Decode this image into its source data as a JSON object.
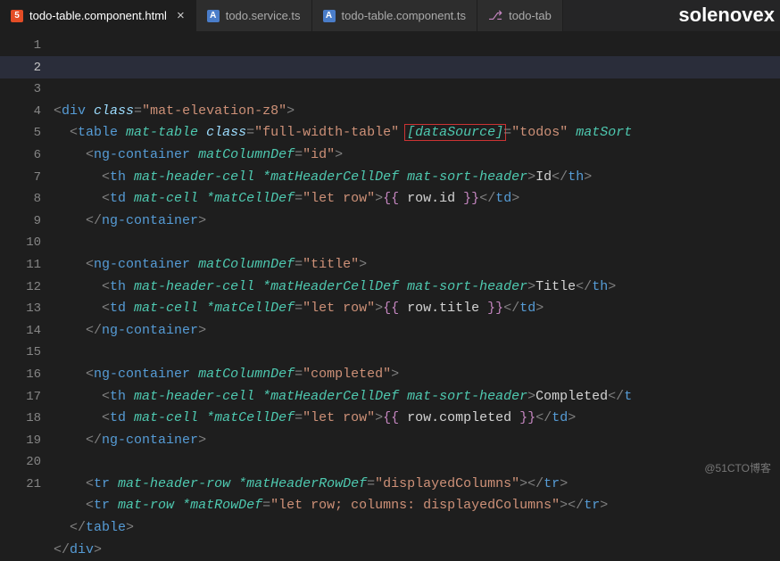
{
  "tabs": [
    {
      "label": "todo-table.component.html",
      "icon": "html",
      "active": true,
      "closeVisible": true
    },
    {
      "label": "todo.service.ts",
      "icon": "ts",
      "active": false,
      "closeVisible": false
    },
    {
      "label": "todo-table.component.ts",
      "icon": "ts",
      "active": false,
      "closeVisible": false
    },
    {
      "label": "todo-tab",
      "icon": "git",
      "active": false,
      "closeVisible": false
    }
  ],
  "watermark_top": "solenovex",
  "watermark_bottom": "@51CTO博客",
  "gutter_start": 1,
  "gutter_end": 21,
  "current_line": 2,
  "code_lines": [
    [
      {
        "t": "<",
        "c": "punc"
      },
      {
        "t": "div",
        "c": "tag"
      },
      {
        "t": " class",
        "c": "attr"
      },
      {
        "t": "=",
        "c": "punc"
      },
      {
        "t": "\"mat-elevation-z8\"",
        "c": "str"
      },
      {
        "t": ">",
        "c": "punc"
      }
    ],
    [
      {
        "t": "  ",
        "c": "text"
      },
      {
        "t": "<",
        "c": "punc"
      },
      {
        "t": "table",
        "c": "tag"
      },
      {
        "t": " mat-table",
        "c": "dir"
      },
      {
        "t": " class",
        "c": "attr"
      },
      {
        "t": "=",
        "c": "punc"
      },
      {
        "t": "\"full-width-table\"",
        "c": "str"
      },
      {
        "t": " ",
        "c": "text"
      },
      {
        "t": "[dataSource]",
        "c": "dir",
        "box": true
      },
      {
        "t": "=",
        "c": "punc"
      },
      {
        "t": "\"todos\"",
        "c": "str"
      },
      {
        "t": " matSort",
        "c": "dir"
      }
    ],
    [
      {
        "t": "    ",
        "c": "text"
      },
      {
        "t": "<",
        "c": "punc"
      },
      {
        "t": "ng-container",
        "c": "tag"
      },
      {
        "t": " matColumnDef",
        "c": "dir"
      },
      {
        "t": "=",
        "c": "punc"
      },
      {
        "t": "\"id\"",
        "c": "str"
      },
      {
        "t": ">",
        "c": "punc"
      }
    ],
    [
      {
        "t": "      ",
        "c": "text"
      },
      {
        "t": "<",
        "c": "punc"
      },
      {
        "t": "th",
        "c": "tag"
      },
      {
        "t": " mat-header-cell",
        "c": "dir"
      },
      {
        "t": " *matHeaderCellDef",
        "c": "dir"
      },
      {
        "t": " mat-sort-header",
        "c": "dir"
      },
      {
        "t": ">",
        "c": "punc"
      },
      {
        "t": "Id",
        "c": "text"
      },
      {
        "t": "</",
        "c": "punc"
      },
      {
        "t": "th",
        "c": "tag"
      },
      {
        "t": ">",
        "c": "punc"
      }
    ],
    [
      {
        "t": "      ",
        "c": "text"
      },
      {
        "t": "<",
        "c": "punc"
      },
      {
        "t": "td",
        "c": "tag"
      },
      {
        "t": " mat-cell",
        "c": "dir"
      },
      {
        "t": " *matCellDef",
        "c": "dir"
      },
      {
        "t": "=",
        "c": "punc"
      },
      {
        "t": "\"let row\"",
        "c": "str"
      },
      {
        "t": ">",
        "c": "punc"
      },
      {
        "t": "{{ ",
        "c": "brace"
      },
      {
        "t": "row.id",
        "c": "ident"
      },
      {
        "t": " }}",
        "c": "brace"
      },
      {
        "t": "</",
        "c": "punc"
      },
      {
        "t": "td",
        "c": "tag"
      },
      {
        "t": ">",
        "c": "punc"
      }
    ],
    [
      {
        "t": "    ",
        "c": "text"
      },
      {
        "t": "</",
        "c": "punc"
      },
      {
        "t": "ng-container",
        "c": "tag"
      },
      {
        "t": ">",
        "c": "punc"
      }
    ],
    [],
    [
      {
        "t": "    ",
        "c": "text"
      },
      {
        "t": "<",
        "c": "punc"
      },
      {
        "t": "ng-container",
        "c": "tag"
      },
      {
        "t": " matColumnDef",
        "c": "dir"
      },
      {
        "t": "=",
        "c": "punc"
      },
      {
        "t": "\"title\"",
        "c": "str"
      },
      {
        "t": ">",
        "c": "punc"
      }
    ],
    [
      {
        "t": "      ",
        "c": "text"
      },
      {
        "t": "<",
        "c": "punc"
      },
      {
        "t": "th",
        "c": "tag"
      },
      {
        "t": " mat-header-cell",
        "c": "dir"
      },
      {
        "t": " *matHeaderCellDef",
        "c": "dir"
      },
      {
        "t": " mat-sort-header",
        "c": "dir"
      },
      {
        "t": ">",
        "c": "punc"
      },
      {
        "t": "Title",
        "c": "text"
      },
      {
        "t": "</",
        "c": "punc"
      },
      {
        "t": "th",
        "c": "tag"
      },
      {
        "t": ">",
        "c": "punc"
      }
    ],
    [
      {
        "t": "      ",
        "c": "text"
      },
      {
        "t": "<",
        "c": "punc"
      },
      {
        "t": "td",
        "c": "tag"
      },
      {
        "t": " mat-cell",
        "c": "dir"
      },
      {
        "t": " *matCellDef",
        "c": "dir"
      },
      {
        "t": "=",
        "c": "punc"
      },
      {
        "t": "\"let row\"",
        "c": "str"
      },
      {
        "t": ">",
        "c": "punc"
      },
      {
        "t": "{{ ",
        "c": "brace"
      },
      {
        "t": "row.title",
        "c": "ident"
      },
      {
        "t": " }}",
        "c": "brace"
      },
      {
        "t": "</",
        "c": "punc"
      },
      {
        "t": "td",
        "c": "tag"
      },
      {
        "t": ">",
        "c": "punc"
      }
    ],
    [
      {
        "t": "    ",
        "c": "text"
      },
      {
        "t": "</",
        "c": "punc"
      },
      {
        "t": "ng-container",
        "c": "tag"
      },
      {
        "t": ">",
        "c": "punc"
      }
    ],
    [],
    [
      {
        "t": "    ",
        "c": "text"
      },
      {
        "t": "<",
        "c": "punc"
      },
      {
        "t": "ng-container",
        "c": "tag"
      },
      {
        "t": " matColumnDef",
        "c": "dir"
      },
      {
        "t": "=",
        "c": "punc"
      },
      {
        "t": "\"completed\"",
        "c": "str"
      },
      {
        "t": ">",
        "c": "punc"
      }
    ],
    [
      {
        "t": "      ",
        "c": "text"
      },
      {
        "t": "<",
        "c": "punc"
      },
      {
        "t": "th",
        "c": "tag"
      },
      {
        "t": " mat-header-cell",
        "c": "dir"
      },
      {
        "t": " *matHeaderCellDef",
        "c": "dir"
      },
      {
        "t": " mat-sort-header",
        "c": "dir"
      },
      {
        "t": ">",
        "c": "punc"
      },
      {
        "t": "Completed",
        "c": "text"
      },
      {
        "t": "</",
        "c": "punc"
      },
      {
        "t": "t",
        "c": "tag"
      }
    ],
    [
      {
        "t": "      ",
        "c": "text"
      },
      {
        "t": "<",
        "c": "punc"
      },
      {
        "t": "td",
        "c": "tag"
      },
      {
        "t": " mat-cell",
        "c": "dir"
      },
      {
        "t": " *matCellDef",
        "c": "dir"
      },
      {
        "t": "=",
        "c": "punc"
      },
      {
        "t": "\"let row\"",
        "c": "str"
      },
      {
        "t": ">",
        "c": "punc"
      },
      {
        "t": "{{ ",
        "c": "brace"
      },
      {
        "t": "row.completed",
        "c": "ident"
      },
      {
        "t": " }}",
        "c": "brace"
      },
      {
        "t": "</",
        "c": "punc"
      },
      {
        "t": "td",
        "c": "tag"
      },
      {
        "t": ">",
        "c": "punc"
      }
    ],
    [
      {
        "t": "    ",
        "c": "text"
      },
      {
        "t": "</",
        "c": "punc"
      },
      {
        "t": "ng-container",
        "c": "tag"
      },
      {
        "t": ">",
        "c": "punc"
      }
    ],
    [],
    [
      {
        "t": "    ",
        "c": "text"
      },
      {
        "t": "<",
        "c": "punc"
      },
      {
        "t": "tr",
        "c": "tag"
      },
      {
        "t": " mat-header-row",
        "c": "dir"
      },
      {
        "t": " *matHeaderRowDef",
        "c": "dir"
      },
      {
        "t": "=",
        "c": "punc"
      },
      {
        "t": "\"displayedColumns\"",
        "c": "str"
      },
      {
        "t": "></",
        "c": "punc"
      },
      {
        "t": "tr",
        "c": "tag"
      },
      {
        "t": ">",
        "c": "punc"
      }
    ],
    [
      {
        "t": "    ",
        "c": "text"
      },
      {
        "t": "<",
        "c": "punc"
      },
      {
        "t": "tr",
        "c": "tag"
      },
      {
        "t": " mat-row",
        "c": "dir"
      },
      {
        "t": " *matRowDef",
        "c": "dir"
      },
      {
        "t": "=",
        "c": "punc"
      },
      {
        "t": "\"let row; columns: displayedColumns\"",
        "c": "str"
      },
      {
        "t": "></",
        "c": "punc"
      },
      {
        "t": "tr",
        "c": "tag"
      },
      {
        "t": ">",
        "c": "punc"
      }
    ],
    [
      {
        "t": "  ",
        "c": "text"
      },
      {
        "t": "</",
        "c": "punc"
      },
      {
        "t": "table",
        "c": "tag"
      },
      {
        "t": ">",
        "c": "punc"
      }
    ],
    [
      {
        "t": "</",
        "c": "punc"
      },
      {
        "t": "div",
        "c": "tag"
      },
      {
        "t": ">",
        "c": "punc"
      }
    ]
  ]
}
